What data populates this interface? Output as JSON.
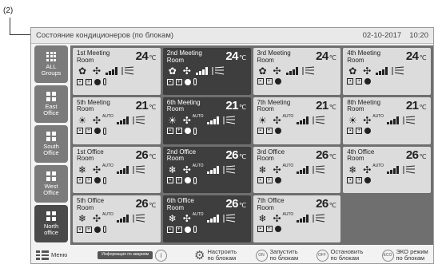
{
  "callout": "(2)",
  "header": {
    "title": "Состояние кондиционеров (по блокам)",
    "date": "02-10-2017",
    "time": "10:20"
  },
  "sidebar": {
    "items": [
      {
        "label_line1": "ALL",
        "label_line2": "Groups",
        "active": false
      },
      {
        "label_line1": "East",
        "label_line2": "Office",
        "active": false
      },
      {
        "label_line1": "South",
        "label_line2": "Office",
        "active": false
      },
      {
        "label_line1": "West",
        "label_line2": "Office",
        "active": false
      },
      {
        "label_line1": "North",
        "label_line2": "office",
        "active": true
      }
    ]
  },
  "units": [
    {
      "name": "1st Meeting Room",
      "temp": "24",
      "unit": "℃",
      "dark": false
    },
    {
      "name": "2nd Meeting Room",
      "temp": "24",
      "unit": "℃",
      "dark": true
    },
    {
      "name": "3rd Meeting Room",
      "temp": "24",
      "unit": "℃",
      "dark": false
    },
    {
      "name": "4th Meeting Room",
      "temp": "24",
      "unit": "℃",
      "dark": false
    },
    {
      "name": "5th Meeting Room",
      "temp": "21",
      "unit": "℃",
      "dark": false
    },
    {
      "name": "6th Meeting Room",
      "temp": "21",
      "unit": "℃",
      "dark": true
    },
    {
      "name": "7th Meeting Room",
      "temp": "21",
      "unit": "℃",
      "dark": false
    },
    {
      "name": "8th Meeting Room",
      "temp": "21",
      "unit": "℃",
      "dark": false
    },
    {
      "name": "1st Office Room",
      "temp": "26",
      "unit": "℃",
      "dark": false
    },
    {
      "name": "2nd Office Room",
      "temp": "26",
      "unit": "℃",
      "dark": true
    },
    {
      "name": "3rd Office Room",
      "temp": "26",
      "unit": "℃",
      "dark": false
    },
    {
      "name": "4th Office Room",
      "temp": "26",
      "unit": "℃",
      "dark": false
    },
    {
      "name": "5th Office Room",
      "temp": "26",
      "unit": "℃",
      "dark": false
    },
    {
      "name": "6th Office Room",
      "temp": "26",
      "unit": "℃",
      "dark": true
    },
    {
      "name": "7th Office Room",
      "temp": "26",
      "unit": "℃",
      "dark": false
    }
  ],
  "bottombar": {
    "menu": "Меню",
    "info_button": "Информация по авариям",
    "configure": "Настроить по блокам",
    "start": "Запустить по блокам",
    "stop": "Остановить по блокам",
    "eco": "ЭКО режим по блокам",
    "on_badge": "ON",
    "off_badge": "OFF",
    "eco_badge": "ECO"
  }
}
